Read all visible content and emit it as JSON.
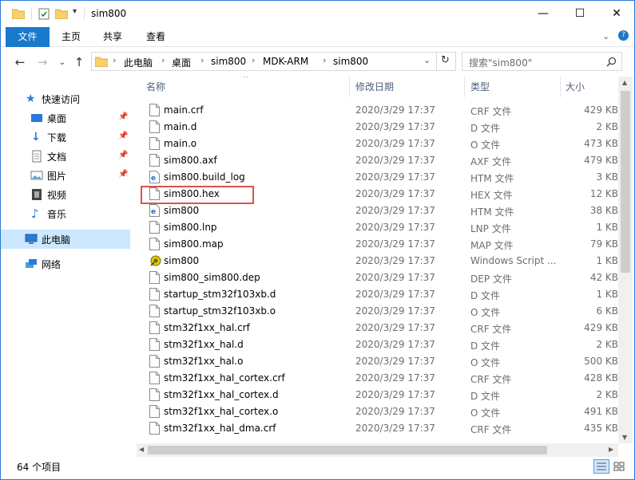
{
  "window": {
    "title": "sim800",
    "minimize": "—",
    "maximize": "☐",
    "close": "✕"
  },
  "ribbon": {
    "tabs": [
      {
        "label": "文件"
      },
      {
        "label": "主页"
      },
      {
        "label": "共享"
      },
      {
        "label": "查看"
      }
    ]
  },
  "address": {
    "crumbs": [
      "此电脑",
      "桌面",
      "sim800",
      "MDK-ARM",
      "sim800"
    ],
    "search_placeholder": "搜索\"sim800\""
  },
  "nav": {
    "items": [
      {
        "label": "快速访问",
        "icon": "star-icon",
        "pinned": false
      },
      {
        "label": "桌面",
        "icon": "desktop-icon",
        "pinned": true
      },
      {
        "label": "下载",
        "icon": "download-icon",
        "pinned": true
      },
      {
        "label": "文档",
        "icon": "document-icon",
        "pinned": true
      },
      {
        "label": "图片",
        "icon": "picture-icon",
        "pinned": true
      },
      {
        "label": "视频",
        "icon": "video-icon",
        "pinned": false
      },
      {
        "label": "音乐",
        "icon": "music-icon",
        "pinned": false
      },
      {
        "label": "此电脑",
        "icon": "computer-icon",
        "pinned": false
      },
      {
        "label": "网络",
        "icon": "network-icon",
        "pinned": false
      }
    ]
  },
  "columns": {
    "name": "名称",
    "date": "修改日期",
    "type": "类型",
    "size": "大小"
  },
  "files": [
    {
      "name": "main.crf",
      "date": "2020/3/29 17:37",
      "type": "CRF 文件",
      "size": "429 KB",
      "icon": "file-icon"
    },
    {
      "name": "main.d",
      "date": "2020/3/29 17:37",
      "type": "D 文件",
      "size": "2 KB",
      "icon": "file-icon"
    },
    {
      "name": "main.o",
      "date": "2020/3/29 17:37",
      "type": "O 文件",
      "size": "473 KB",
      "icon": "file-icon"
    },
    {
      "name": "sim800.axf",
      "date": "2020/3/29 17:37",
      "type": "AXF 文件",
      "size": "479 KB",
      "icon": "file-icon"
    },
    {
      "name": "sim800.build_log",
      "date": "2020/3/29 17:37",
      "type": "HTM 文件",
      "size": "3 KB",
      "icon": "html-icon"
    },
    {
      "name": "sim800.hex",
      "date": "2020/3/29 17:37",
      "type": "HEX 文件",
      "size": "12 KB",
      "icon": "file-icon"
    },
    {
      "name": "sim800",
      "date": "2020/3/29 17:37",
      "type": "HTM 文件",
      "size": "38 KB",
      "icon": "html-icon"
    },
    {
      "name": "sim800.lnp",
      "date": "2020/3/29 17:37",
      "type": "LNP 文件",
      "size": "1 KB",
      "icon": "file-icon"
    },
    {
      "name": "sim800.map",
      "date": "2020/3/29 17:37",
      "type": "MAP 文件",
      "size": "79 KB",
      "icon": "file-icon"
    },
    {
      "name": "sim800",
      "date": "2020/3/29 17:37",
      "type": "Windows Script ...",
      "size": "1 KB",
      "icon": "script-icon"
    },
    {
      "name": "sim800_sim800.dep",
      "date": "2020/3/29 17:37",
      "type": "DEP 文件",
      "size": "42 KB",
      "icon": "file-icon"
    },
    {
      "name": "startup_stm32f103xb.d",
      "date": "2020/3/29 17:37",
      "type": "D 文件",
      "size": "1 KB",
      "icon": "file-icon"
    },
    {
      "name": "startup_stm32f103xb.o",
      "date": "2020/3/29 17:37",
      "type": "O 文件",
      "size": "6 KB",
      "icon": "file-icon"
    },
    {
      "name": "stm32f1xx_hal.crf",
      "date": "2020/3/29 17:37",
      "type": "CRF 文件",
      "size": "429 KB",
      "icon": "file-icon"
    },
    {
      "name": "stm32f1xx_hal.d",
      "date": "2020/3/29 17:37",
      "type": "D 文件",
      "size": "2 KB",
      "icon": "file-icon"
    },
    {
      "name": "stm32f1xx_hal.o",
      "date": "2020/3/29 17:37",
      "type": "O 文件",
      "size": "500 KB",
      "icon": "file-icon"
    },
    {
      "name": "stm32f1xx_hal_cortex.crf",
      "date": "2020/3/29 17:37",
      "type": "CRF 文件",
      "size": "428 KB",
      "icon": "file-icon"
    },
    {
      "name": "stm32f1xx_hal_cortex.d",
      "date": "2020/3/29 17:37",
      "type": "D 文件",
      "size": "2 KB",
      "icon": "file-icon"
    },
    {
      "name": "stm32f1xx_hal_cortex.o",
      "date": "2020/3/29 17:37",
      "type": "O 文件",
      "size": "491 KB",
      "icon": "file-icon"
    },
    {
      "name": "stm32f1xx_hal_dma.crf",
      "date": "2020/3/29 17:37",
      "type": "CRF 文件",
      "size": "435 KB",
      "icon": "file-icon"
    }
  ],
  "highlighted_file": "sim800.hex",
  "status": {
    "item_count": "64 个项目"
  },
  "colors": {
    "accent": "#1979ca",
    "selection": "#cce8ff",
    "highlight_box": "#d9534f"
  }
}
